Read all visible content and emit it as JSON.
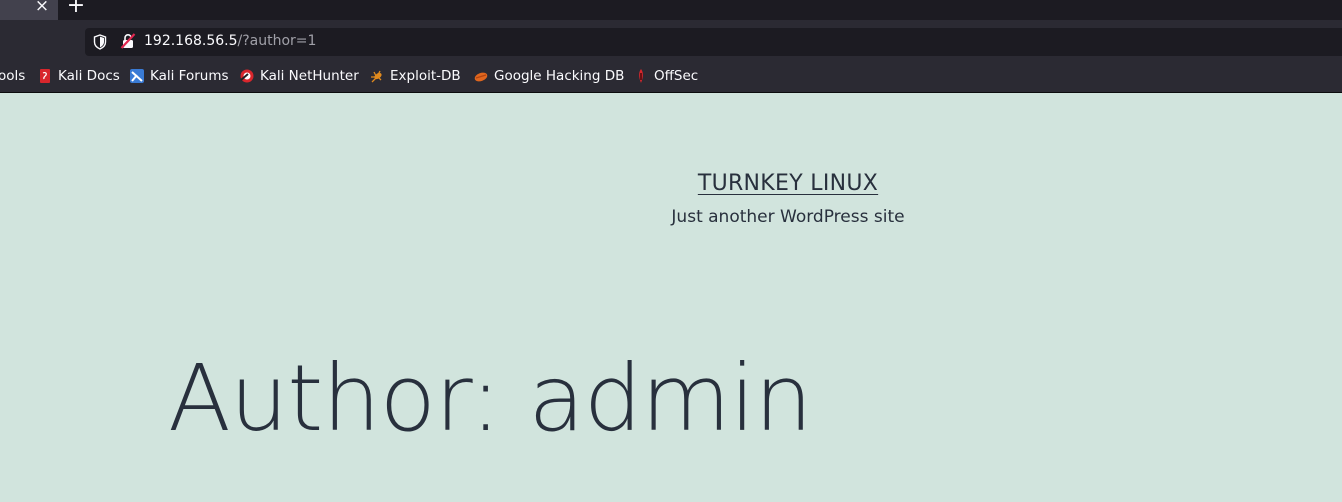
{
  "browser": {
    "tab_close_glyph": "×",
    "new_tab_glyph": "+",
    "url_host": "192.168.56.5",
    "url_path": "/?author=1",
    "bookmarks": [
      {
        "label": "ools",
        "icon": "tools-icon"
      },
      {
        "label": "Kali Docs",
        "icon": "kali-docs-icon"
      },
      {
        "label": "Kali Forums",
        "icon": "kali-forums-icon"
      },
      {
        "label": "Kali NetHunter",
        "icon": "kali-nethunter-icon"
      },
      {
        "label": "Exploit-DB",
        "icon": "exploit-db-icon"
      },
      {
        "label": "Google Hacking DB",
        "icon": "google-hacking-db-icon"
      },
      {
        "label": "OffSec",
        "icon": "offsec-icon"
      }
    ]
  },
  "site": {
    "title": "TURNKEY LINUX",
    "description": "Just another WordPress site",
    "page_heading": "Author: admin"
  },
  "colors": {
    "page_background": "#d1e4dd",
    "text": "#28303d",
    "browser_chrome": "#2b2a33",
    "tab_strip": "#1c1b22"
  }
}
